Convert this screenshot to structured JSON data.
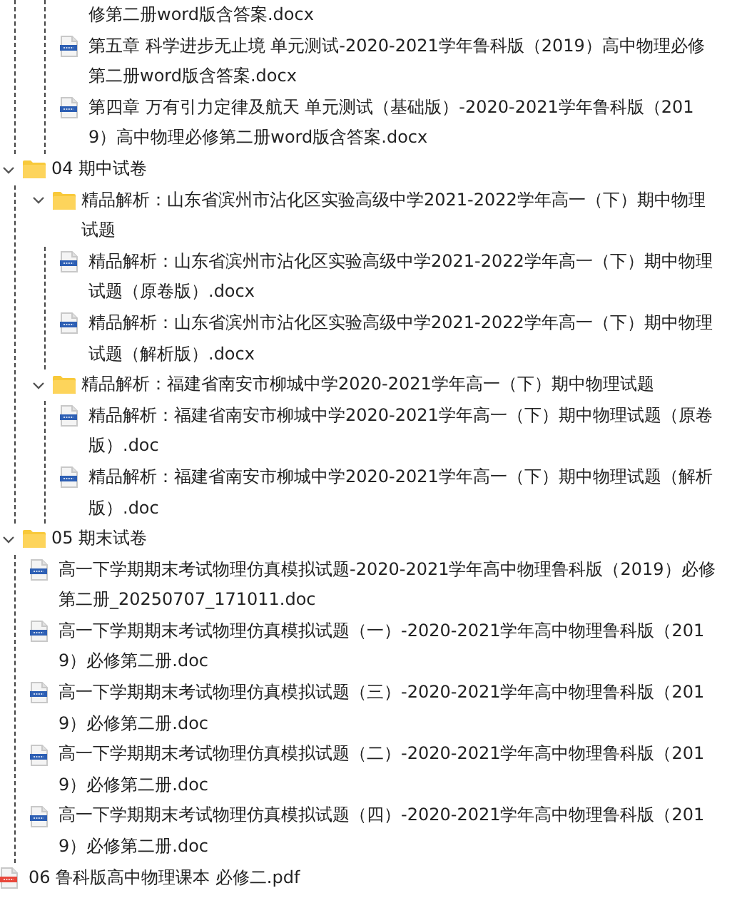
{
  "tree": [
    {
      "kind": "offscreen",
      "children": [
        {
          "kind": "offscreen",
          "children": [
            {
              "kind": "continued",
              "name": "修第二册word版含答案.docx"
            },
            {
              "kind": "word",
              "name": "第五章 科学进步无止境 单元测试-2020-2021学年鲁科版（2019）高中物理必修第二册word版含答案.docx"
            },
            {
              "kind": "word",
              "name": "第四章 万有引力定律及航天 单元测试（基础版）-2020-2021学年鲁科版（2019）高中物理必修第二册word版含答案.docx"
            }
          ]
        }
      ]
    },
    {
      "kind": "folder",
      "name": "04 期中试卷",
      "expanded": true,
      "children": [
        {
          "kind": "folder",
          "name": "精品解析：山东省滨州市沾化区实验高级中学2021-2022学年高一（下）期中物理试题",
          "expanded": true,
          "children": [
            {
              "kind": "word",
              "name": "精品解析：山东省滨州市沾化区实验高级中学2021-2022学年高一（下）期中物理试题（原卷版）.docx"
            },
            {
              "kind": "word",
              "name": "精品解析：山东省滨州市沾化区实验高级中学2021-2022学年高一（下）期中物理试题（解析版）.docx"
            }
          ]
        },
        {
          "kind": "folder",
          "name": "精品解析：福建省南安市柳城中学2020-2021学年高一（下）期中物理试题",
          "expanded": true,
          "children": [
            {
              "kind": "word",
              "name": "精品解析：福建省南安市柳城中学2020-2021学年高一（下）期中物理试题（原卷版）.doc"
            },
            {
              "kind": "word",
              "name": "精品解析：福建省南安市柳城中学2020-2021学年高一（下）期中物理试题（解析版）.doc"
            }
          ]
        }
      ]
    },
    {
      "kind": "folder",
      "name": "05 期末试卷",
      "expanded": true,
      "children": [
        {
          "kind": "word",
          "name": "高一下学期期末考试物理仿真模拟试题-2020-2021学年高中物理鲁科版（2019）必修第二册_20250707_171011.doc"
        },
        {
          "kind": "word",
          "name": "高一下学期期末考试物理仿真模拟试题（一）-2020-2021学年高中物理鲁科版（2019）必修第二册.doc"
        },
        {
          "kind": "word",
          "name": "高一下学期期末考试物理仿真模拟试题（三）-2020-2021学年高中物理鲁科版（2019）必修第二册.doc"
        },
        {
          "kind": "word",
          "name": "高一下学期期末考试物理仿真模拟试题（二）-2020-2021学年高中物理鲁科版（2019）必修第二册.doc"
        },
        {
          "kind": "word",
          "name": "高一下学期期末考试物理仿真模拟试题（四）-2020-2021学年高中物理鲁科版（2019）必修第二册.doc"
        }
      ]
    },
    {
      "kind": "pdf",
      "name": "06 鲁科版高中物理课本 必修二.pdf"
    }
  ]
}
